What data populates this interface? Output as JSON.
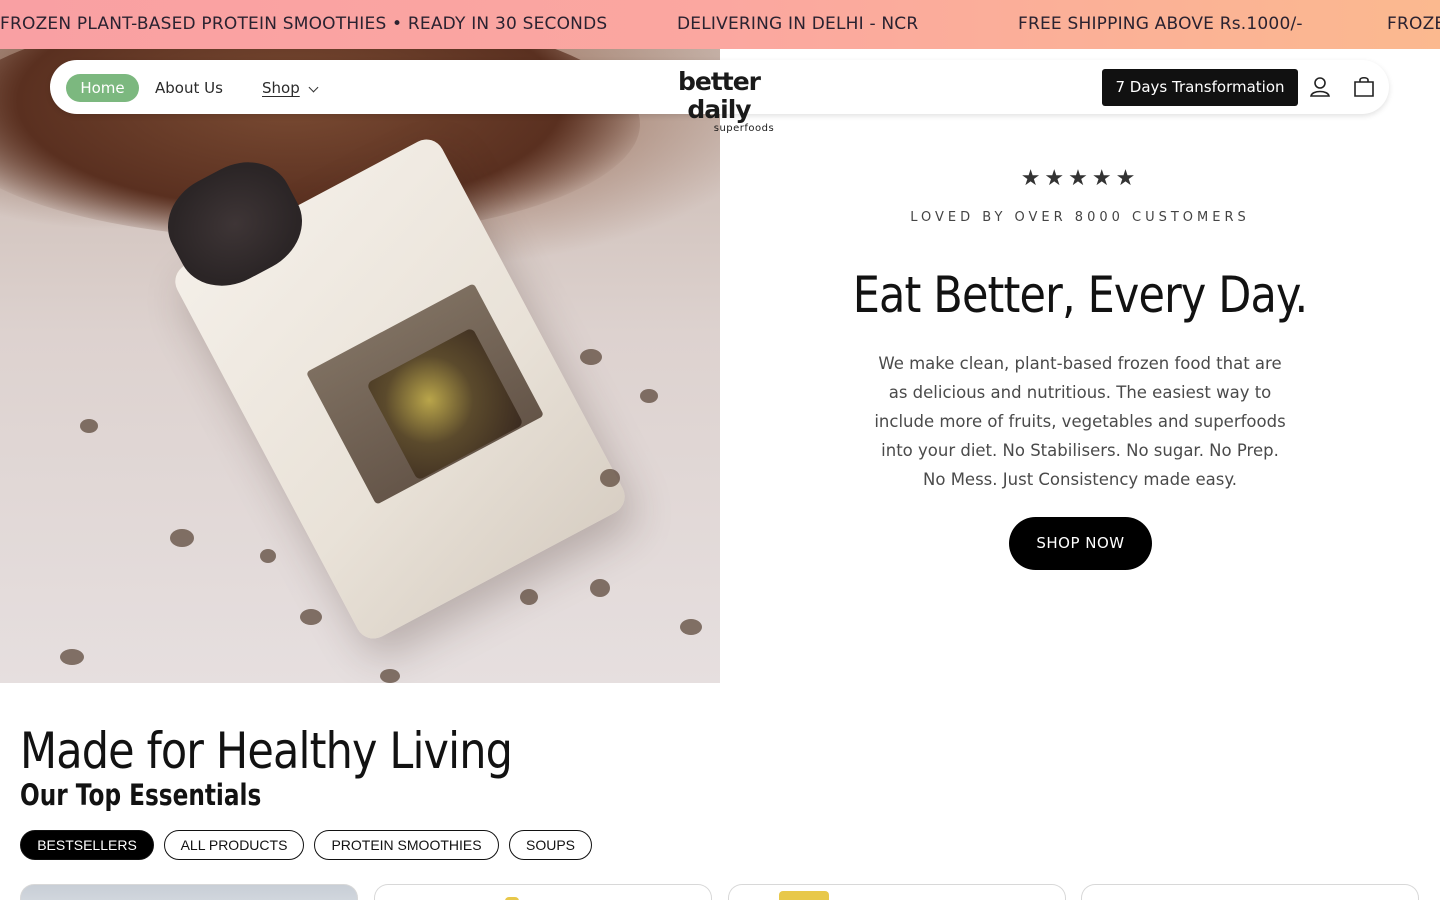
{
  "announcement": {
    "items": [
      "FROZEN PLANT-BASED PROTEIN SMOOTHIES • READY IN 30 SECONDS",
      "DELIVERING IN DELHI - NCR",
      "FREE SHIPPING ABOVE Rs.1000/-",
      "FROZE"
    ],
    "colors": {
      "gradient_start": "#f9a0a3",
      "gradient_end": "#fbb98f"
    }
  },
  "nav": {
    "items": [
      {
        "label": "Home",
        "active": true
      },
      {
        "label": "About Us"
      },
      {
        "label": "Shop"
      }
    ],
    "logo": {
      "main": "better daily",
      "sub": "superfoods"
    },
    "cta_label": "7 Days Transformation",
    "icons": [
      "account-icon",
      "cart-icon"
    ],
    "active_color": "#7cb87f"
  },
  "hero": {
    "stars": "★★★★★",
    "tagline": "LOVED BY OVER 8000 CUSTOMERS",
    "title": "Eat Better, Every Day.",
    "description": "We make clean, plant-based frozen food that are as delicious and nutritious. The easiest way to include more of fruits, vegetables and superfoods into your diet. No Stabilisers. No sugar. No Prep. No Mess. Just Consistency made easy.",
    "button_label": "SHOP NOW"
  },
  "collection": {
    "title": "Made for Healthy Living",
    "subtitle": "Our Top Essentials",
    "filters": [
      {
        "label": "BESTSELLERS",
        "active": true
      },
      {
        "label": "ALL PRODUCTS"
      },
      {
        "label": "PROTEIN SMOOTHIES"
      },
      {
        "label": "SOUPS"
      }
    ]
  }
}
